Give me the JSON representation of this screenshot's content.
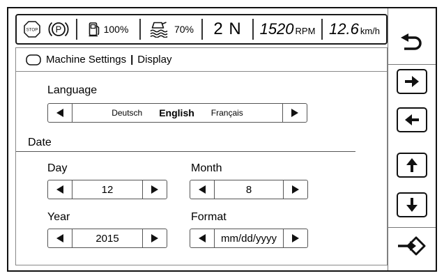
{
  "status_bar": {
    "stop_label": "STOP",
    "parking_label": "P",
    "fuel_level": "100%",
    "def_level": "70%",
    "gear": "2 N",
    "engine_speed": {
      "value": "1520",
      "unit": "RPM"
    },
    "ground_speed": {
      "value": "12.6",
      "unit": "km/h"
    },
    "icons": {
      "stop": "stop-icon",
      "parking": "parking-brake-icon",
      "fuel": "fuel-icon",
      "def": "def-icon"
    }
  },
  "breadcrumb": {
    "icon": "page-icon",
    "section": "Machine Settings",
    "separator": "|",
    "page": "Display"
  },
  "language": {
    "label": "Language",
    "options": [
      "Deutsch",
      "English",
      "Français"
    ],
    "selected_index": 1
  },
  "date": {
    "section_label": "Date",
    "day": {
      "label": "Day",
      "value": "12"
    },
    "month": {
      "label": "Month",
      "value": "8"
    },
    "year": {
      "label": "Year",
      "value": "2015"
    },
    "format": {
      "label": "Format",
      "value": "mm/dd/yyyy"
    }
  },
  "nav_buttons": {
    "back": "back-icon",
    "right": "arrow-right-icon",
    "left": "arrow-left-icon",
    "up": "arrow-up-icon",
    "down": "arrow-down-icon",
    "enter": "enter-icon"
  },
  "colors": {
    "text": "#000000",
    "background": "#ffffff",
    "border": "#888888"
  }
}
